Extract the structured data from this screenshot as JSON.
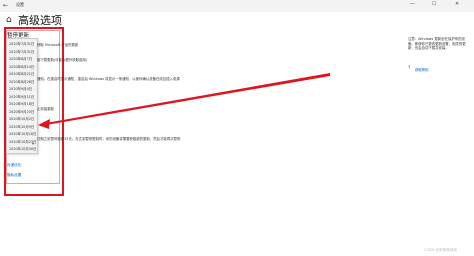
{
  "window": {
    "title": "设置",
    "controls": [
      "—",
      "☐",
      "✕"
    ]
  },
  "header": {
    "title": "高级选项"
  },
  "section": {
    "heading": "暂停更新"
  },
  "dropdown": {
    "items": [
      "2020年7月31日",
      "2020年7月31日",
      "2020年8月7日",
      "2020年8月14日",
      "2020年8月21日",
      "2020年8月28日",
      "2020年9月4日",
      "2020年9月11日",
      "2020年9月18日",
      "2020年9月25日",
      "2020年10月2日",
      "2020年10月9日",
      "2020年10月16日",
      "2020年10月23日",
      "2020年10月30日"
    ]
  },
  "descriptions": {
    "d1": "获取 Microsoft 产品的更新",
    "d2": "接下载更新(可能会额外收取费用)",
    "d3": "通知。在重启时显示通知，重启后 Windows 将显示一条通知，以使你确认设备在线且插入电源",
    "d4": "止安装更新",
    "d5": "日期之前暂停更新35天。在达到暂停限制时，你的设备将需要获取新的更新，然后才能再次暂停"
  },
  "links": {
    "delivery": "传递优化",
    "privacy": "隐私设置"
  },
  "right_panel": {
    "note": "注意：Windows 更新也在保护你的设备。即使你已更改更新设置，相关的更新，也会自动下载并安装。",
    "link": "获取帮助"
  },
  "watermark": "CSDN @宫莲莲网络",
  "colors": {
    "highlight": "#e0141e",
    "link": "#0067c0"
  }
}
